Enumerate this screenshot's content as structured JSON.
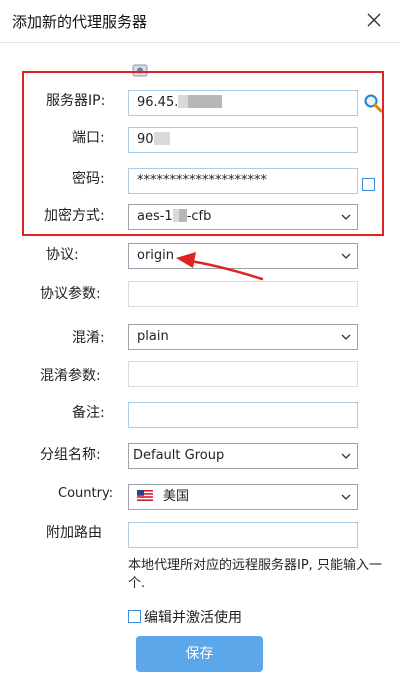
{
  "window": {
    "title": "添加新的代理服务器"
  },
  "form": {
    "server_ip": {
      "label": "服务器IP:",
      "value": "96.45."
    },
    "port": {
      "label": "端口:",
      "value": "90"
    },
    "password": {
      "label": "密码:",
      "value": "********************"
    },
    "encryption": {
      "label": "加密方式:",
      "value_prefix": "aes-1",
      "value_suffix": "-cfb"
    },
    "protocol": {
      "label": "协议:",
      "value": "origin"
    },
    "protocol_param": {
      "label": "协议参数:",
      "value": ""
    },
    "obfs": {
      "label": "混淆:",
      "value": "plain"
    },
    "obfs_param": {
      "label": "混淆参数:",
      "value": ""
    },
    "remark": {
      "label": "备注:",
      "value": ""
    },
    "group": {
      "label": "分组名称:",
      "value": "Default Group"
    },
    "country": {
      "label": "Country:",
      "value": "美国",
      "flag_icon": "us-flag-icon"
    },
    "extra_route": {
      "label": "附加路由",
      "value": ""
    },
    "note": "本地代理所对应的远程服务器IP, 只能输入一个.",
    "edit_activate_label": "编辑并激活使用",
    "save_label": "保存"
  },
  "colors": {
    "highlight": "#e02424",
    "save_button": "#5ba7ea",
    "input_border": "#a9cde8"
  }
}
